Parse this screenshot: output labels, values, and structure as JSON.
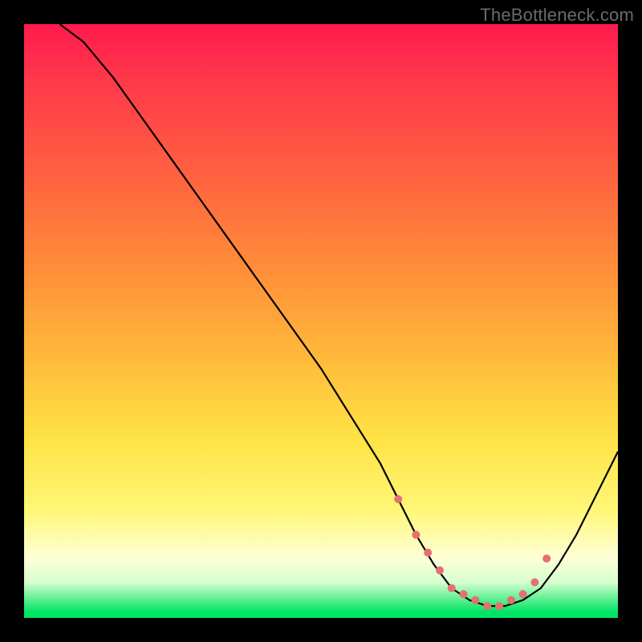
{
  "watermark": "TheBottleneck.com",
  "chart_data": {
    "type": "line",
    "title": "",
    "xlabel": "",
    "ylabel": "",
    "xlim": [
      0,
      100
    ],
    "ylim": [
      0,
      100
    ],
    "series": [
      {
        "name": "bottleneck-curve",
        "x": [
          6,
          10,
          15,
          20,
          25,
          30,
          35,
          40,
          45,
          50,
          55,
          60,
          63,
          66,
          69,
          72,
          75,
          78,
          81,
          84,
          87,
          90,
          93,
          96,
          100
        ],
        "y": [
          100,
          97,
          91,
          84,
          77,
          70,
          63,
          56,
          49,
          42,
          34,
          26,
          20,
          14,
          9,
          5,
          3,
          2,
          2,
          3,
          5,
          9,
          14,
          20,
          28
        ]
      }
    ],
    "markers": {
      "name": "optimal-range-dots",
      "x": [
        63,
        66,
        68,
        70,
        72,
        74,
        76,
        78,
        80,
        82,
        84,
        86,
        88
      ],
      "y": [
        20,
        14,
        11,
        8,
        5,
        4,
        3,
        2,
        2,
        3,
        4,
        6,
        10
      ]
    },
    "background": {
      "stops": [
        {
          "pos": 0,
          "color": "#ff1a4d"
        },
        {
          "pos": 25,
          "color": "#ff6040"
        },
        {
          "pos": 55,
          "color": "#ffb63a"
        },
        {
          "pos": 82,
          "color": "#fff778"
        },
        {
          "pos": 99,
          "color": "#00e463"
        }
      ]
    }
  }
}
